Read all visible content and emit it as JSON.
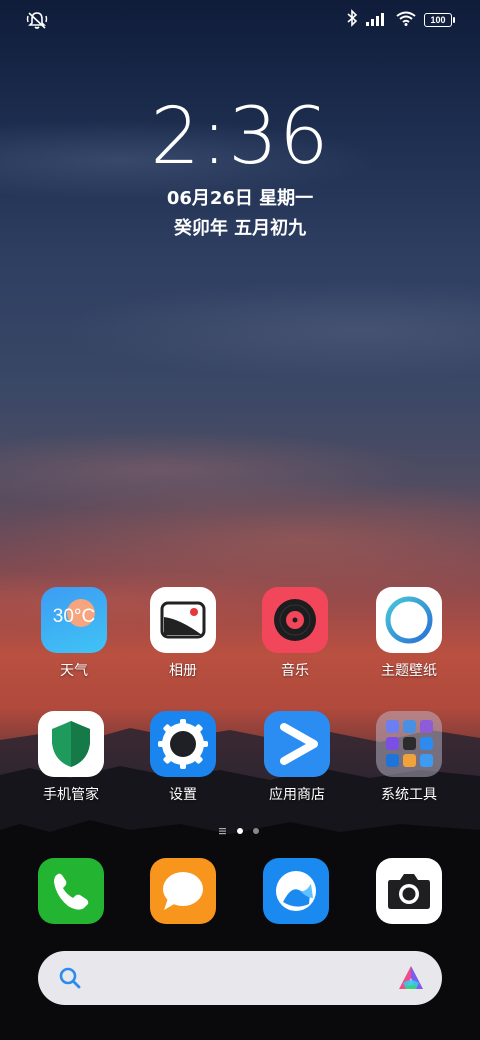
{
  "status_bar": {
    "left_icon": "muted-bell-icon",
    "right_icons": [
      "bluetooth-icon",
      "signal-icon",
      "wifi-icon",
      "battery-icon"
    ],
    "battery": "100"
  },
  "lockclock": {
    "time": "2:36",
    "date": "06月26日 星期一",
    "lunar": "癸卯年 五月初九"
  },
  "apps": {
    "row1": [
      {
        "label": "天气",
        "icon": "weather-icon",
        "temp": "30°C"
      },
      {
        "label": "相册",
        "icon": "gallery-icon"
      },
      {
        "label": "音乐",
        "icon": "music-icon"
      },
      {
        "label": "主题壁纸",
        "icon": "themes-icon"
      }
    ],
    "row2": [
      {
        "label": "手机管家",
        "icon": "security-icon"
      },
      {
        "label": "设置",
        "icon": "settings-icon"
      },
      {
        "label": "应用商店",
        "icon": "app-store-icon"
      },
      {
        "label": "系统工具",
        "icon": "folder-icon"
      }
    ]
  },
  "page_indicator": {
    "pages": 2,
    "active": 1
  },
  "dock": [
    "phone-icon",
    "messages-icon",
    "browser-icon",
    "camera-icon"
  ],
  "search": {
    "left_icon": "search-icon",
    "right_icon": "assistant-logo-icon"
  }
}
